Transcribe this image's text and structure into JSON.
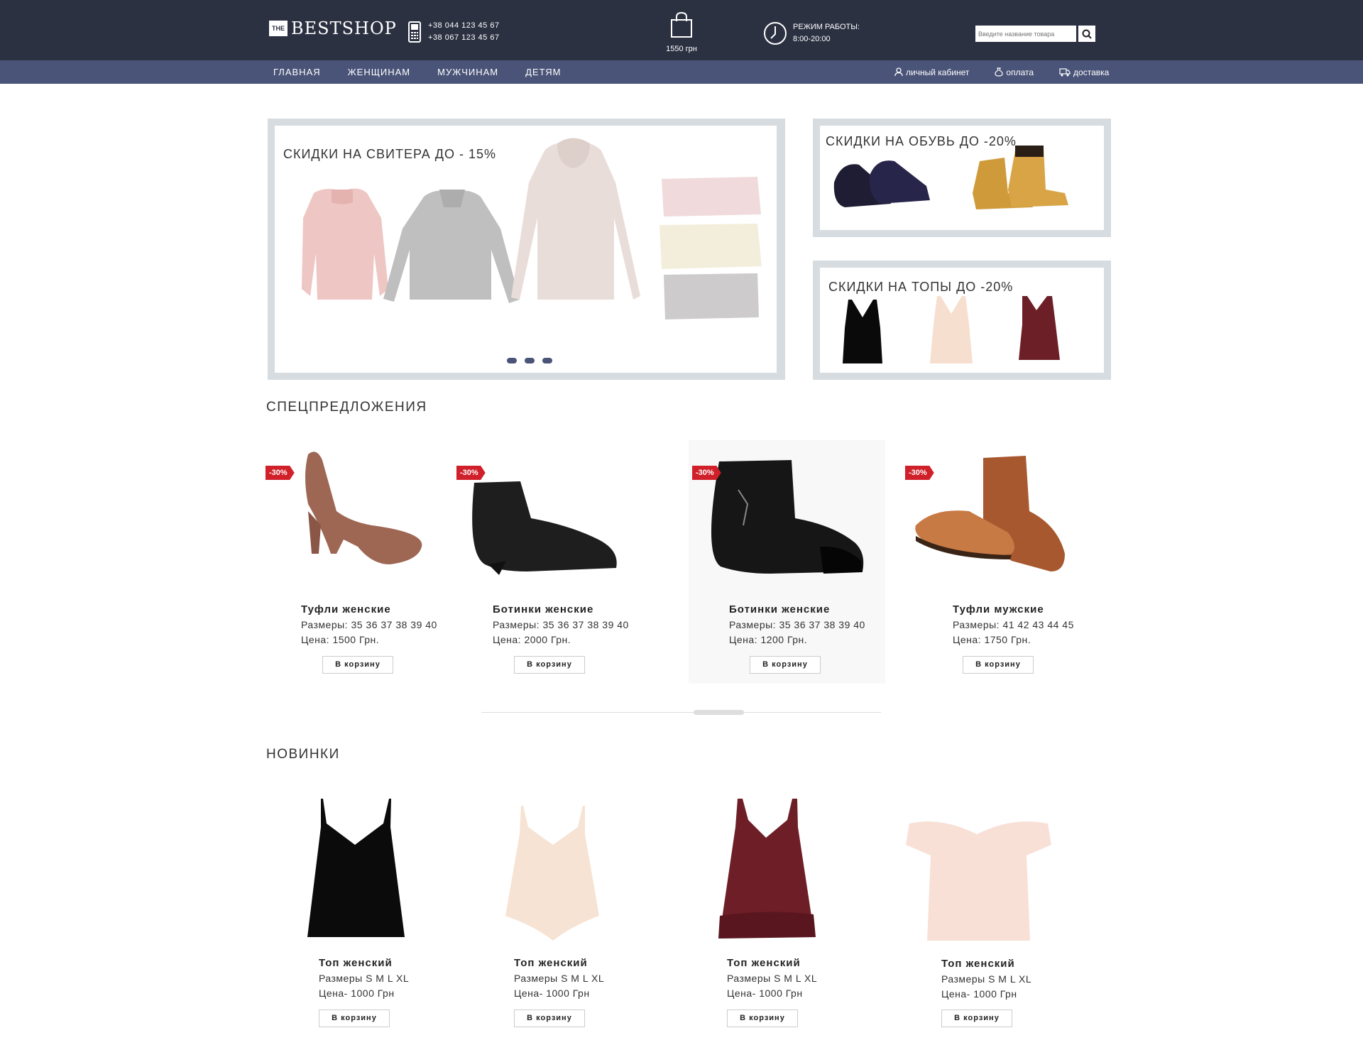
{
  "header": {
    "logo_the": "THE",
    "logo_name": "BESTSHOP",
    "phone1": "+38 044 123 45 67",
    "phone2": "+38 067 123 45 67",
    "cart_total": "1550 грн",
    "hours_label": "РЕЖИМ РАБОТЫ:",
    "hours_value": "8:00-20:00",
    "search_placeholder": "Введите название товара"
  },
  "nav": {
    "items": [
      "ГЛАВНАЯ",
      "ЖЕНЩИНАМ",
      "МУЖЧИНАМ",
      "ДЕТЯМ"
    ],
    "right": [
      {
        "label": "личный кабинет",
        "icon": "user-icon"
      },
      {
        "label": "оплата",
        "icon": "money-icon"
      },
      {
        "label": "доставка",
        "icon": "truck-icon"
      }
    ]
  },
  "banners": {
    "main_title": "СКИДКИ НА СВИТЕРА ДО - 15%",
    "shoes_title": "СКИДКИ НА ОБУВЬ ДО -20%",
    "tops_title": "СКИДКИ НА ТОПЫ ДО -20%"
  },
  "special": {
    "title": "СПЕЦПРЕДЛОЖЕНИЯ",
    "items": [
      {
        "badge": "-30%",
        "name": "Туфли женские",
        "sizes": "Размеры: 35 36 37 38 39 40",
        "price": "Цена: 1500 Грн.",
        "button": "В корзину"
      },
      {
        "badge": "-30%",
        "name": "Ботинки женские",
        "sizes": "Размеры: 35 36 37 38 39 40",
        "price": "Цена: 2000 Грн.",
        "button": "В корзину"
      },
      {
        "badge": "-30%",
        "name": "Ботинки женские",
        "sizes": "Размеры: 35 36 37 38 39 40",
        "price": "Цена: 1200 Грн.",
        "button": "В корзину"
      },
      {
        "badge": "-30%",
        "name": "Туфли мужские",
        "sizes": "Размеры: 41 42 43 44 45",
        "price": "Цена: 1750 Грн.",
        "button": "В корзину"
      }
    ]
  },
  "new": {
    "title": "НОВИНКИ",
    "items": [
      {
        "name": "Топ женский",
        "sizes": "Размеры S M L XL",
        "price": "Цена- 1000 Грн",
        "button": "В корзину"
      },
      {
        "name": "Топ женский",
        "sizes": "Размеры S M L XL",
        "price": "Цена- 1000 Грн",
        "button": "В корзину"
      },
      {
        "name": "Топ женский",
        "sizes": "Размеры S M L XL",
        "price": "Цена- 1000 Грн",
        "button": "В корзину"
      },
      {
        "name": "Топ женский",
        "sizes": "Размеры S M L XL",
        "price": "Цена- 1000 Грн",
        "button": "В корзину"
      }
    ]
  },
  "colors": {
    "header_bg": "#2c3142",
    "nav_bg": "#4a5478",
    "badge": "#d0202a"
  }
}
